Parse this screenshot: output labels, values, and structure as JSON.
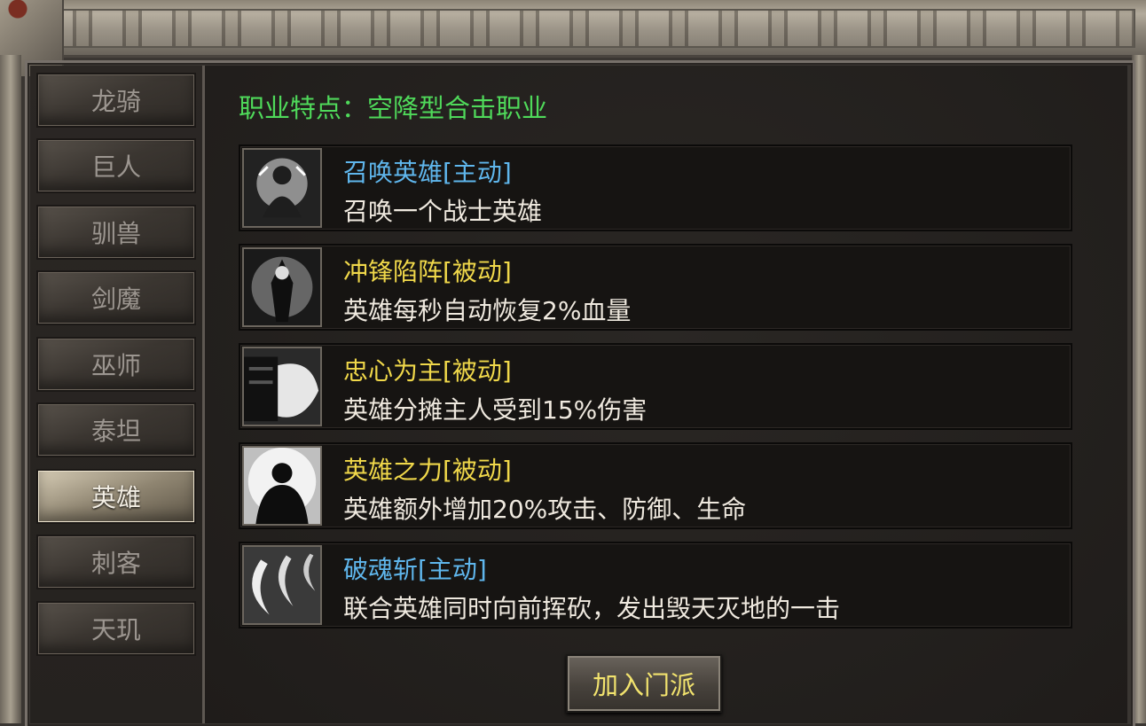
{
  "classes": [
    {
      "label": "龙骑",
      "active": false
    },
    {
      "label": "巨人",
      "active": false
    },
    {
      "label": "驯兽",
      "active": false
    },
    {
      "label": "剑魔",
      "active": false
    },
    {
      "label": "巫师",
      "active": false
    },
    {
      "label": "泰坦",
      "active": false
    },
    {
      "label": "英雄",
      "active": true
    },
    {
      "label": "刺客",
      "active": false
    },
    {
      "label": "天玑",
      "active": false
    }
  ],
  "trait_label": "职业特点：空降型合击职业",
  "skills": [
    {
      "name": "召唤英雄[主动]",
      "desc": "召唤一个战士英雄",
      "type": "active",
      "icon": "summon-hero-icon"
    },
    {
      "name": "冲锋陷阵[被动]",
      "desc": "英雄每秒自动恢复2%血量",
      "type": "passive",
      "icon": "charge-icon"
    },
    {
      "name": "忠心为主[被动]",
      "desc": "英雄分摊主人受到15%伤害",
      "type": "passive",
      "icon": "loyalty-icon"
    },
    {
      "name": "英雄之力[被动]",
      "desc": "英雄额外增加20%攻击、防御、生命",
      "type": "passive",
      "icon": "hero-power-icon"
    },
    {
      "name": "破魂斩[主动]",
      "desc": "联合英雄同时向前挥砍，发出毁天灭地的一击",
      "type": "active",
      "icon": "soul-slash-icon"
    }
  ],
  "join_button": "加入门派",
  "colors": {
    "active_skill": "#5fb6ec",
    "passive_skill": "#f0d84a",
    "trait_text": "#4fd95a",
    "description": "#efe9df"
  }
}
